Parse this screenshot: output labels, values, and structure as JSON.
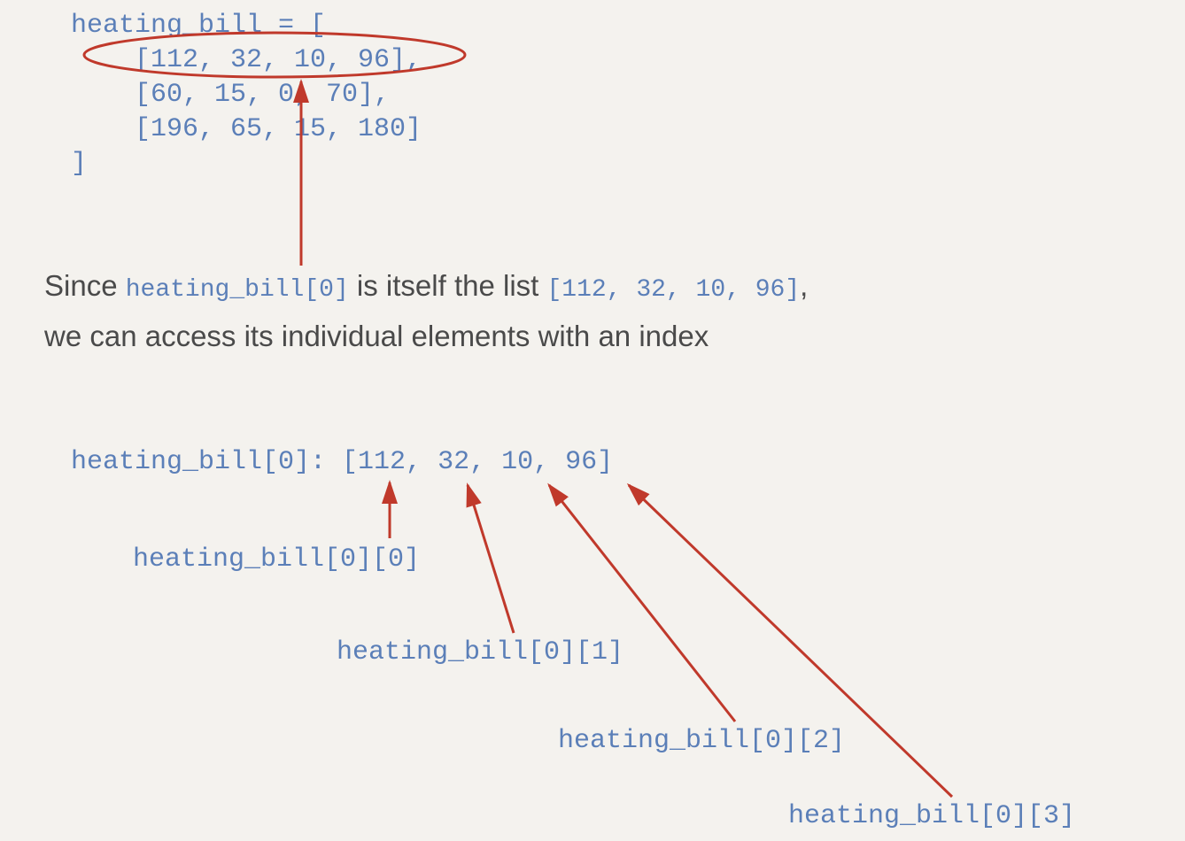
{
  "code_block": {
    "line1": "heating_bill = [",
    "line2": "    [112, 32, 10, 96],",
    "line3": "    [60, 15, 0, 70],",
    "line4": "    [196, 65, 15, 180]",
    "line5": "]"
  },
  "paragraph": {
    "t1": "Since ",
    "c1": "heating_bill[0]",
    "t2": " is itself the list ",
    "c2": "[112, 32, 10, 96]",
    "t3": ",",
    "t4": "we can access its individual elements with an index"
  },
  "row0": "heating_bill[0]: [112, 32, 10, 96]",
  "labels": {
    "i0": "heating_bill[0][0]",
    "i1": "heating_bill[0][1]",
    "i2": "heating_bill[0][2]",
    "i3": "heating_bill[0][3]"
  },
  "list_data": {
    "variable": "heating_bill",
    "rows": [
      [
        112,
        32,
        10,
        96
      ],
      [
        60,
        15,
        0,
        70
      ],
      [
        196,
        65,
        15,
        180
      ]
    ],
    "highlighted_row_index": 0
  },
  "colors": {
    "code": "#5b7fb8",
    "text": "#4a4a4a",
    "annotation": "#c0392b"
  }
}
